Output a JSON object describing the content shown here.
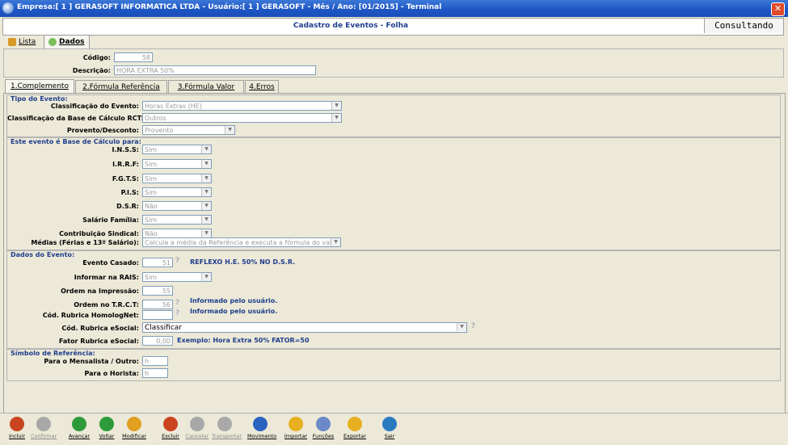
{
  "window": {
    "title": "Empresa:[ 1 ] GERASOFT INFORMATICA LTDA  -  Usuário:[  1 ] GERASOFT  -  Mês / Ano: [01/2015]  -  Terminal"
  },
  "header": {
    "title": "Cadastro de Eventos - Folha",
    "mode": "Consultando"
  },
  "top_tabs": {
    "lista": "Lista",
    "dados": "Dados"
  },
  "record": {
    "codigo_label": "Código:",
    "codigo_value": "58",
    "descricao_label": "Descrição:",
    "descricao_value": "HORA EXTRA 50%"
  },
  "tabs": [
    "1.Complemento",
    "2.Fórmula Referência",
    "3.Fórmula Valor",
    "4.Erros"
  ],
  "tipo": {
    "title": "Tipo do Evento:",
    "classificacao_label": "Classificação do Evento:",
    "classificacao_value": "Horas Extras (HE)",
    "rct_label": "Classificação da Base de Cálculo RCT:",
    "rct_value": "Outros",
    "provento_label": "Provento/Desconto:",
    "provento_value": "Provento"
  },
  "base": {
    "title": "Este evento é Base de Cálculo para:",
    "inss_label": "I.N.S.S:",
    "inss_value": "Sim",
    "irrf_label": "I.R.R.F:",
    "irrf_value": "Sim",
    "fgts_label": "F.G.T.S:",
    "fgts_value": "Sim",
    "pis_label": "P.I.S:",
    "pis_value": "Sim",
    "dsr_label": "D.S.R:",
    "dsr_value": "Não",
    "salfam_label": "Salário Família:",
    "salfam_value": "Sim",
    "contrib_label": "Contribuição Sindical:",
    "contrib_value": "Não",
    "medias_label": "Médias (Férias e 13º Salário):",
    "medias_value": "Calcula a média da Referência e executa a fórmula do valor"
  },
  "dados": {
    "title": "Dados do Evento:",
    "casado_label": "Evento Casado:",
    "casado_value": "51",
    "casado_desc": "REFLEXO H.E. 50% NO D.S.R.",
    "rais_label": "Informar na RAIS:",
    "rais_value": "Sim",
    "ordem_imp_label": "Ordem na Impressão:",
    "ordem_imp_value": "55",
    "ordem_trct_label": "Ordem no T.R.C.T:",
    "ordem_trct_value": "56",
    "ordem_trct_note": "Informado pelo usuário.",
    "homolog_label": "Cód. Rubrica HomologNet:",
    "homolog_value": "",
    "homolog_note": "Informado pelo usuário.",
    "esocial_label": "Cód. Rubrica eSocial:",
    "esocial_value": "Classificar",
    "fator_label": "Fator Rubrica eSocial:",
    "fator_value": "0,00",
    "fator_note": "Exemplo: Hora Extra 50% FATOR=50"
  },
  "simbolo": {
    "title": "Símbolo de Referência:",
    "mensal_label": "Para o Mensalista / Outro:",
    "mensal_value": "h",
    "horista_label": "Para o Horista:",
    "horista_value": "h"
  },
  "toolbar": [
    {
      "label": "Incluir",
      "color": "#c9441f"
    },
    {
      "label": "Confirmar",
      "color": "#a8a8a8"
    },
    {
      "label": "Avançar",
      "color": "#2e9a3a"
    },
    {
      "label": "Voltar",
      "color": "#2e9a3a"
    },
    {
      "label": "Modificar",
      "color": "#e0a020"
    },
    {
      "label": "Excluir",
      "color": "#c9441f"
    },
    {
      "label": "Cancelar",
      "color": "#a8a8a8"
    },
    {
      "label": "Transportar",
      "color": "#a8a8a8"
    },
    {
      "label": "Movimento",
      "color": "#2a64c0"
    },
    {
      "label": "Importar",
      "color": "#e8b020"
    },
    {
      "label": "Funções",
      "color": "#6a8ac8"
    },
    {
      "label": "Exportar",
      "color": "#e8b020"
    },
    {
      "label": "Sair",
      "color": "#2a7ac0"
    }
  ]
}
